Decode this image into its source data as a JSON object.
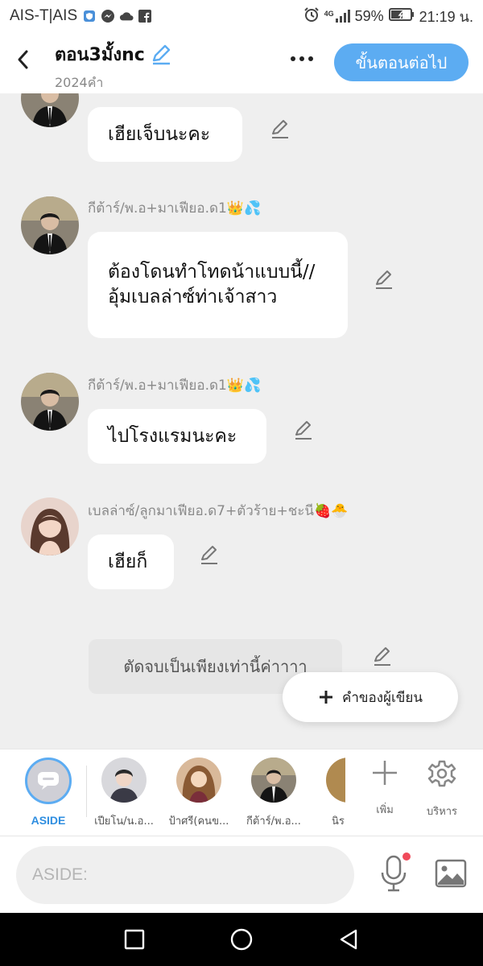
{
  "status_bar": {
    "carrier": "AIS-T|AIS",
    "network": "4G",
    "battery": "59%",
    "time": "21:19 น."
  },
  "header": {
    "title": "ตอน3มั้งnc",
    "word_count": "2024คำ",
    "next_label": "ขั้นตอนต่อไป"
  },
  "messages": [
    {
      "sender": "",
      "text": "เฮียเจ็บนะคะ",
      "avatar": "boy-avatar"
    },
    {
      "sender": "กีต้าร์/พ.อ+มาเฟียอ.ด1",
      "sender_emojis": "👑💦",
      "text": "ต้องโดนทำโทดน้าแบบนี้//อุ้มเบลล่าซ์ท่าเจ้าสาว",
      "avatar": "boy-avatar"
    },
    {
      "sender": "กีต้าร์/พ.อ+มาเฟียอ.ด1",
      "sender_emojis": "👑💦",
      "text": "ไปโรงแรมนะคะ",
      "avatar": "boy-avatar"
    },
    {
      "sender": "เบลล่าซ์/ลูกมาเฟียอ.ด7+ตัวร้าย+ชะนี",
      "sender_emojis": "🍓🐣",
      "text": "เฮียก็",
      "avatar": "girl-avatar"
    }
  ],
  "narration": {
    "text": "ตัดจบเป็นเพียงเท่านี้ค่าาาา"
  },
  "writer_button": {
    "label": "คำของผู้เขียน"
  },
  "characters": {
    "aside_label": "ASIDE",
    "items": [
      {
        "label": "เปียโน/น.อ...",
        "avatar": "boy-b"
      },
      {
        "label": "ป้าศรี(คนข...",
        "avatar": "woman-avatar"
      },
      {
        "label": "กีต้าร์/พ.อ...",
        "avatar": "boy-avatar"
      },
      {
        "label": "นิร",
        "avatar": "partial"
      }
    ],
    "add_label": "เพิ่ม",
    "manage_label": "บริหาร"
  },
  "input": {
    "placeholder": "ASIDE:"
  },
  "colors": {
    "accent": "#5cacf2",
    "aside_label": "#2f8ee0",
    "background": "#efefef",
    "mic_dot": "#f04a5a"
  }
}
